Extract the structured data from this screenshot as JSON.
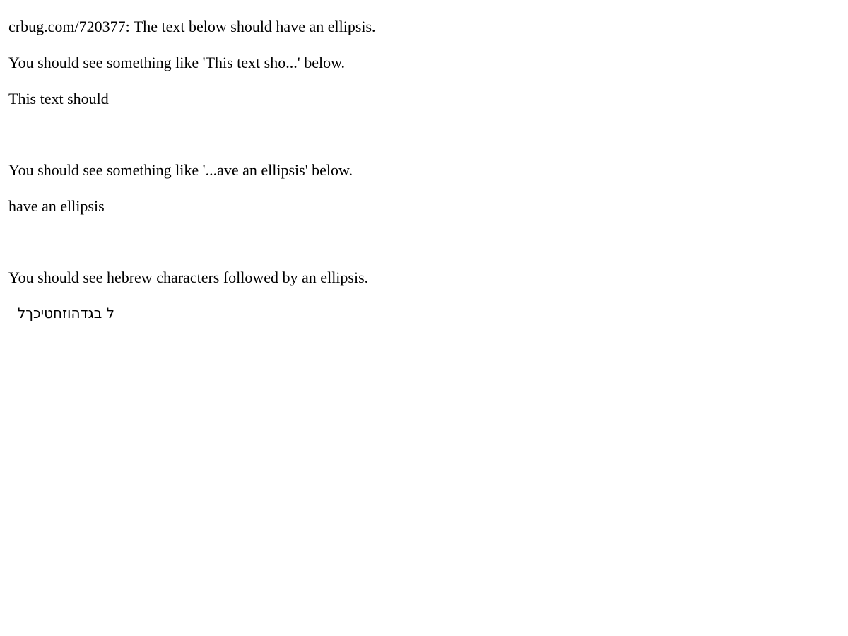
{
  "intro": "crbug.com/720377: The text below should have an ellipsis.",
  "test1": {
    "instruction": "You should see something like 'This text sho...' below.",
    "sample": "This text should"
  },
  "test2": {
    "instruction": "You should see something like '...ave an ellipsis' below.",
    "sample": "have an ellipsis"
  },
  "test3": {
    "instruction": "You should see hebrew characters followed by an ellipsis.",
    "sample": "ל בגדהוזחטיכךל"
  }
}
